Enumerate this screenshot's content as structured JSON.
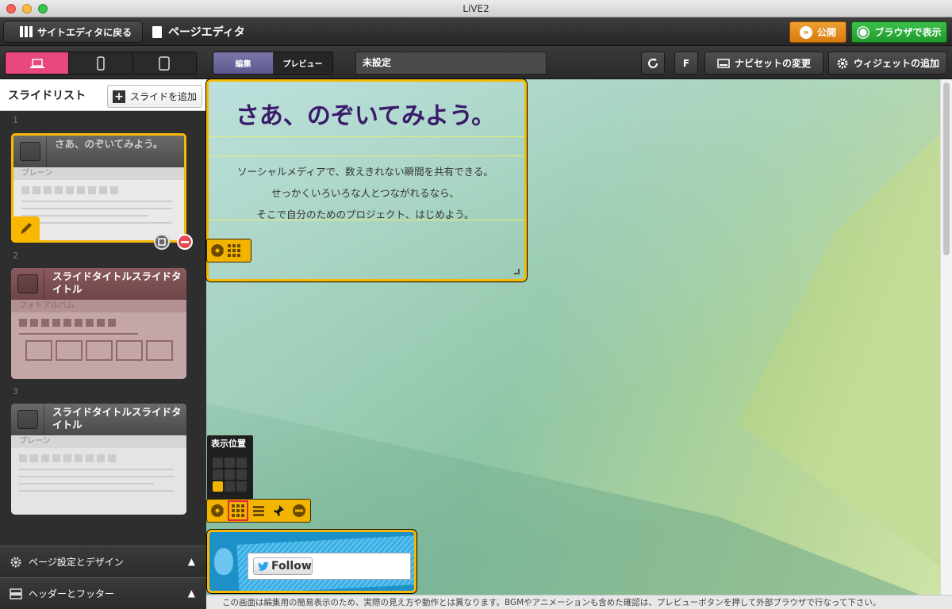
{
  "window": {
    "title": "LiVE2"
  },
  "topbar": {
    "back_label": "サイトエディタに戻る",
    "page_title": "ページエディタ",
    "publish_label": "公開",
    "browser_label": "ブラウザで表示"
  },
  "toolbar": {
    "mode_edit": "編集",
    "mode_preview": "プレビュー",
    "status_value": "未設定",
    "font_label": "F",
    "navset_label": "ナビセットの変更",
    "widget_add_label": "ウィジェットの追加"
  },
  "sidebar": {
    "title": "スライドリスト",
    "add_slide_label": "スライドを追加",
    "slides": [
      {
        "num": "1",
        "title": "さあ、のぞいてみよう。",
        "type": "プレーン"
      },
      {
        "num": "2",
        "title": "スライドタイトルスライドタイトル",
        "type": "フォトアルバム"
      },
      {
        "num": "3",
        "title": "スライドタイトルスライドタイトル",
        "type": "プレーン"
      }
    ],
    "accordion": [
      {
        "label": "ページ設定とデザイン"
      },
      {
        "label": "ヘッダーとフッター"
      }
    ]
  },
  "canvas": {
    "heading": "さあ、のぞいてみよう。",
    "body_lines": [
      "ソーシャルメディアで、数えきれない瞬間を共有できる。",
      "せっかくいろいろな人とつながれるなら、",
      "そこで自分のためのプロジェクト、はじめよう。"
    ],
    "position_panel_title": "表示位置",
    "follow_label": "Follow"
  },
  "footer_note": "この画面は編集用の簡易表示のため、実際の見え方や動作とは異なります。BGMやアニメーションも含めた確認は、プレビューボタンを押して外部ブラウザで行なって下さい。",
  "colors": {
    "accent_pink": "#e8477f",
    "widget_yellow": "#f8b800",
    "publish_orange": "#e68a1a",
    "browser_green": "#27a836",
    "heading_purple": "#3a1b6a"
  },
  "icons": {
    "device_desktop": "laptop-icon",
    "device_phone": "phone-icon",
    "device_tablet": "tablet-icon"
  }
}
